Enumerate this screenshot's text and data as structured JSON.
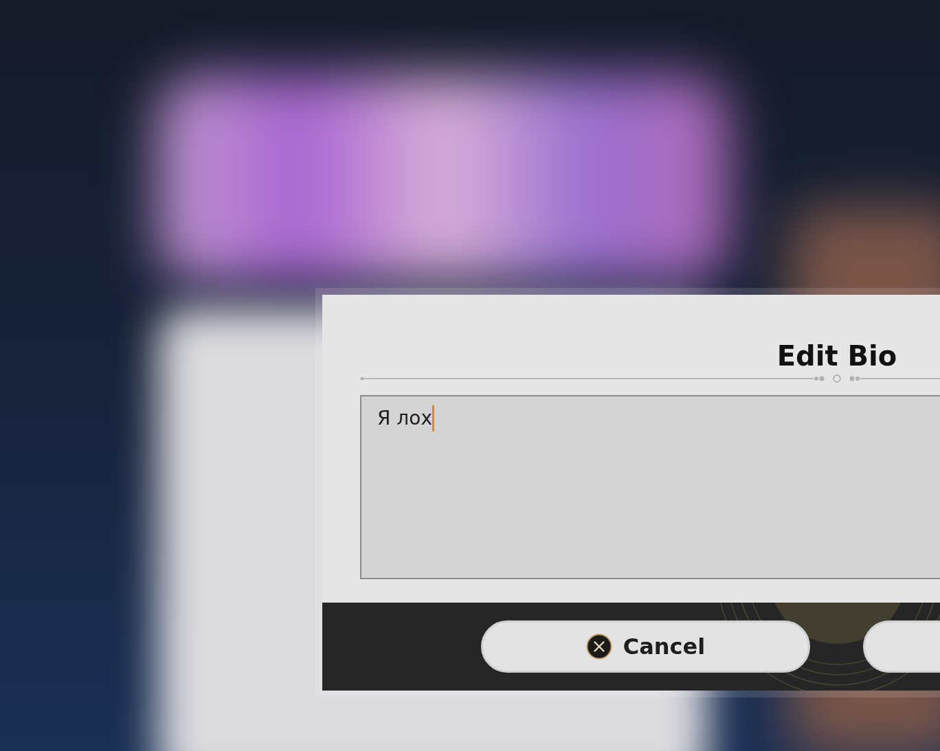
{
  "dialog": {
    "title": "Edit Bio",
    "field": {
      "value": "Я лох",
      "focused": true
    },
    "buttons": [
      {
        "kind": "cancel",
        "label": "Cancel"
      },
      {
        "kind": "confirm"
      }
    ]
  }
}
